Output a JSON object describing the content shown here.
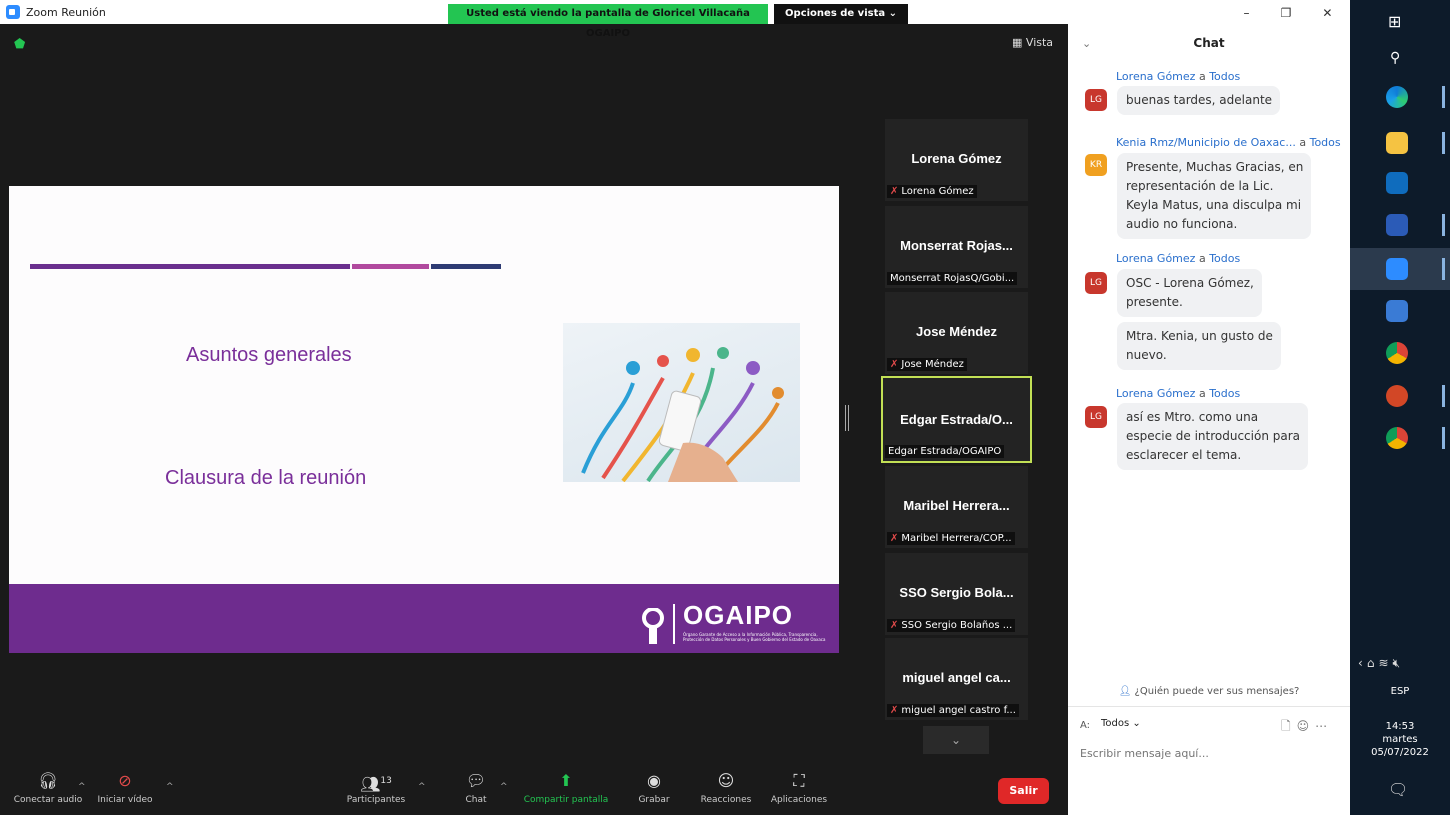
{
  "window": {
    "title": "Zoom Reunión",
    "share_banner": "Usted está viendo la pantalla de Gloricel Villacaña OGAIPO",
    "view_options": "Opciones de vista ⌄",
    "vista_button": "Vista",
    "controls": [
      "–",
      "❐",
      "✕"
    ]
  },
  "slide": {
    "item1": "Asuntos generales",
    "item2": "Clausura de la reunión",
    "logo_name": "OGAIPO",
    "logo_subtitle": "Órgano Garante de Acceso a la Información Pública, Transparencia, Protección de Datos Personales y Buen Gobierno del Estado de Oaxaca",
    "colors": {
      "bar1": "#6a2f8e",
      "bar2": "#b1499e",
      "bar3": "#2e3b73",
      "footer": "#6e2c8e",
      "accent": "#7a2f9a"
    }
  },
  "participants": [
    {
      "name": "Lorena Gómez",
      "label": "Lorena Gómez",
      "muted": true,
      "active": false
    },
    {
      "name": "Monserrat Rojas...",
      "label": "Monserrat RojasQ/Gobi...",
      "muted": false,
      "active": false
    },
    {
      "name": "Jose Méndez",
      "label": "Jose Méndez",
      "muted": true,
      "active": false
    },
    {
      "name": "Edgar Estrada/O...",
      "label": "Edgar Estrada/OGAIPO",
      "muted": false,
      "active": true
    },
    {
      "name": "Maribel Herrera...",
      "label": "Maribel Herrera/COP...",
      "muted": true,
      "active": false
    },
    {
      "name": "SSO Sergio Bola...",
      "label": "SSO Sergio Bolaños ...",
      "muted": true,
      "active": false
    },
    {
      "name": "miguel angel ca...",
      "label": "miguel angel castro f...",
      "muted": true,
      "active": false
    }
  ],
  "toolbar": {
    "audio": "Conectar audio",
    "video": "Iniciar vídeo",
    "participants": "Participantes",
    "participants_count": "13",
    "chat": "Chat",
    "share": "Compartir pantalla",
    "record": "Grabar",
    "reactions": "Reacciones",
    "apps": "Aplicaciones",
    "leave": "Salir"
  },
  "chat": {
    "title": "Chat",
    "messages": [
      {
        "from": "Lorena Gómez",
        "to_sep": "a",
        "to": "Todos",
        "initials": "LG",
        "color": "#c8372d",
        "lines": [
          "buenas tardes, adelante"
        ]
      },
      {
        "from": "Kenia Rmz/Municipio de Oaxac...",
        "to_sep": "a",
        "to": "Todos",
        "initials": "KR",
        "color": "#f0a020",
        "lines": [
          "Presente, Muchas Gracias, en",
          "representación de la Lic.",
          "Keyla Matus, una disculpa mi",
          "audio no funciona."
        ]
      },
      {
        "from": "Lorena Gómez",
        "to_sep": "a",
        "to": "Todos",
        "initials": "LG",
        "color": "#c8372d",
        "lines": [
          "OSC - Lorena Gómez,",
          "presente."
        ],
        "extra": [
          "Mtra. Kenia, un gusto de",
          "nuevo."
        ]
      },
      {
        "from": "Lorena Gómez",
        "to_sep": "a",
        "to": "Todos",
        "initials": "LG",
        "color": "#c8372d",
        "lines": [
          "así es Mtro. como una",
          "especie de introducción para",
          "esclarecer el tema."
        ]
      }
    ],
    "who_can_see": "¿Quién puede ver sus mensajes?",
    "to_label": "A:",
    "to_value": "Todos ⌄",
    "input_placeholder": "Escribir mensaje aquí..."
  },
  "taskbar": {
    "language": "ESP",
    "time": "14:53",
    "day": "martes",
    "date": "05/07/2022"
  }
}
